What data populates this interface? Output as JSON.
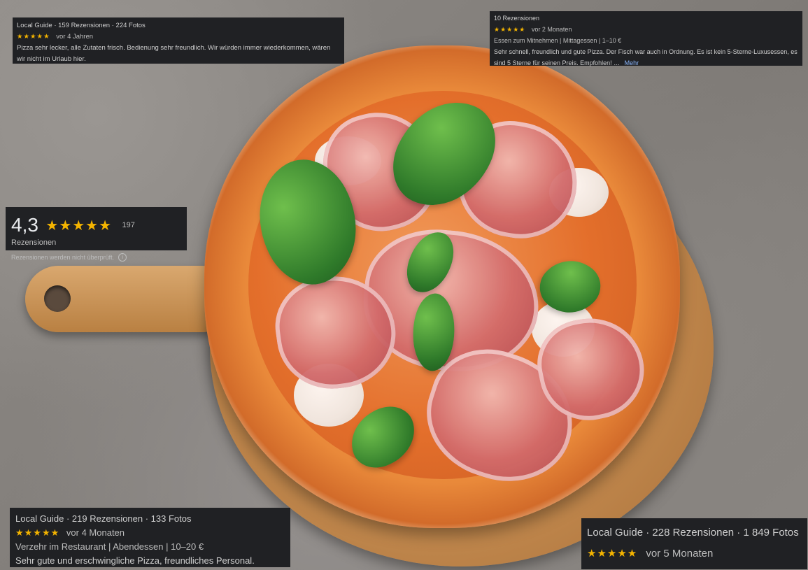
{
  "overlays": {
    "top_left": {
      "meta": "Local Guide · 159 Rezensionen · 224 Fotos",
      "stars": "★★★★★",
      "age": "vor 4 Jahren",
      "text": "Pizza sehr lecker, alle Zutaten frisch. Bedienung sehr freundlich. Wir würden immer wiederkommen, wären wir nicht im Urlaub hier."
    },
    "top_right": {
      "meta": "10 Rezensionen",
      "stars": "★★★★★",
      "age": "vor 2 Monaten",
      "tags": "Essen zum Mitnehmen  |  Mittagessen  |  1–10 €",
      "text": "Sehr schnell, freundlich und gute Pizza. Der Fisch war auch in Ordnung. Es ist kein 5-Sterne-Luxusessen, es sind 5 Sterne für seinen Preis. Empfohlen! …",
      "more": "Mehr"
    },
    "rating_box": {
      "value": "4,3",
      "stars": "★★★★★",
      "count": "197 Rezensionen",
      "note": "Rezensionen werden nicht überprüft.",
      "info_icon": "i"
    },
    "bottom_left": {
      "meta": "Local Guide · 219 Rezensionen · 133 Fotos",
      "stars": "★★★★★",
      "age": "vor 4 Monaten",
      "tags": "Verzehr im Restaurant  |  Abendessen  |  10–20 €",
      "text": "Sehr gute und erschwingliche Pizza, freundliches Personal."
    },
    "bottom_right": {
      "meta": "Local Guide · 228 Rezensionen · 1 849 Fotos",
      "stars": "★★★★★",
      "age": "vor 5 Monaten"
    }
  },
  "colors": {
    "overlay_bg": "#202124",
    "star": "#f4b400",
    "link": "#8ab4f8"
  }
}
